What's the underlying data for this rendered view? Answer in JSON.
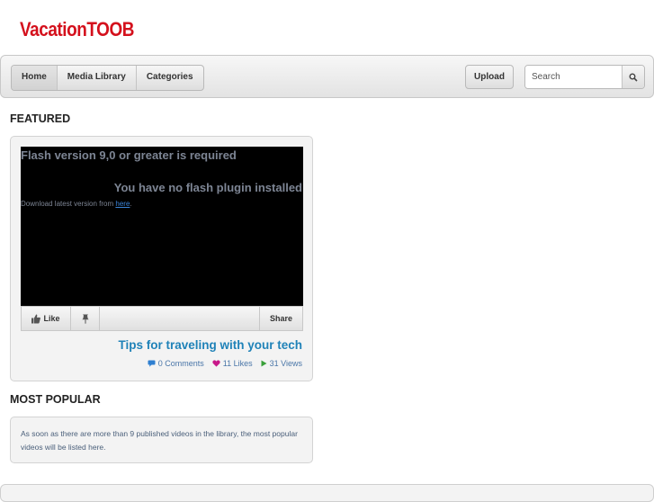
{
  "site": {
    "logo": "VacationTOOB"
  },
  "nav": {
    "items": [
      {
        "label": "Home",
        "active": true
      },
      {
        "label": "Media Library",
        "active": false
      },
      {
        "label": "Categories",
        "active": false
      }
    ],
    "upload_label": "Upload",
    "search_placeholder": "Search"
  },
  "featured": {
    "heading": "FEATURED",
    "player": {
      "flash_required": "Flash version 9,0 or greater is required",
      "no_plugin": "You have no flash plugin installed",
      "download_prefix": "Download latest version from ",
      "download_link": "here",
      "download_suffix": "."
    },
    "toolbar": {
      "like_label": "Like",
      "share_label": "Share"
    },
    "video": {
      "title": "Tips for traveling with your tech",
      "comments": "0 Comments",
      "likes": "11 Likes",
      "views": "31 Views"
    }
  },
  "most_popular": {
    "heading": "MOST POPULAR",
    "message": "As soon as there are more than 9 published videos in the library, the most popular videos will be listed here."
  },
  "colors": {
    "logo": "#d4101c",
    "link": "#1f82b8",
    "heart": "#c8198a",
    "play": "#3aa03a",
    "comment": "#2f7fd0"
  },
  "icons": {
    "like": "thumbs-up-icon",
    "pin": "pushpin-icon",
    "search": "magnifier-icon",
    "comments": "comment-icon",
    "likes": "heart-icon",
    "views": "play-icon"
  }
}
